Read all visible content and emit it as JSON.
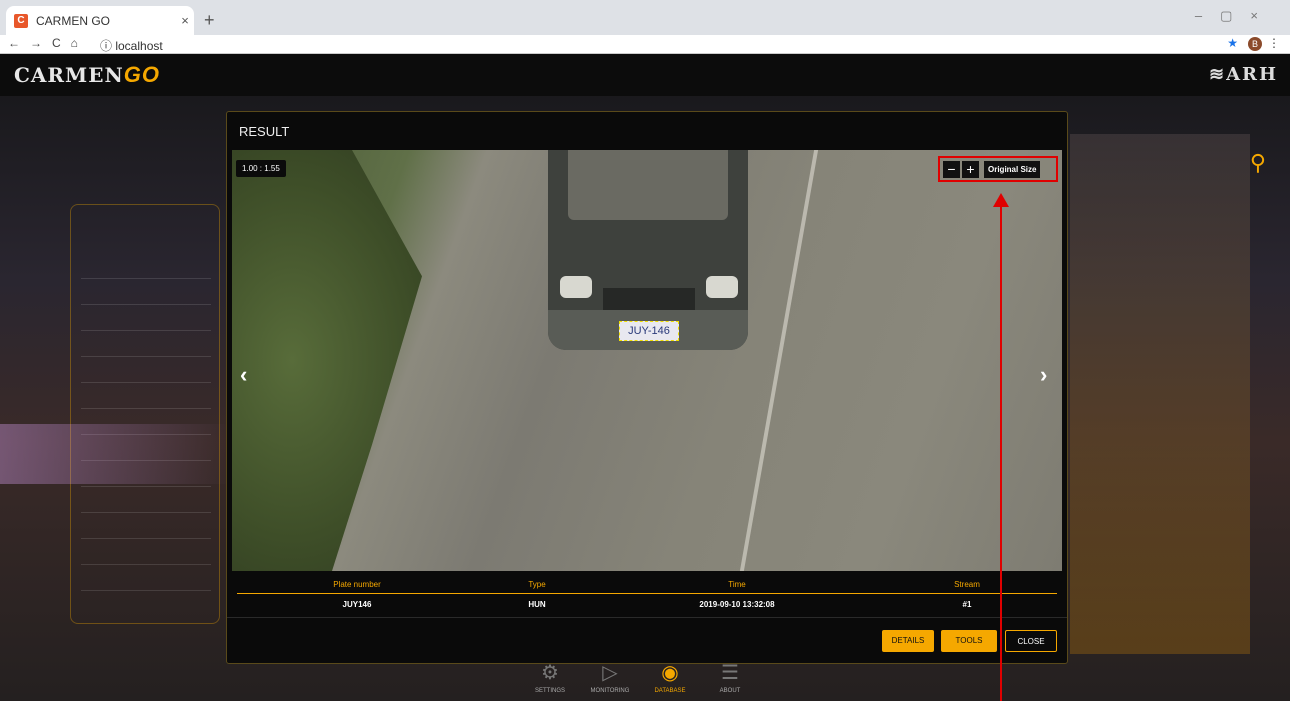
{
  "browser": {
    "tab_title": "CARMEN GO",
    "url": "localhost",
    "profile_initial": "B"
  },
  "app": {
    "logo_text": "CARMEN",
    "logo_go": "GO",
    "brand": "ARH"
  },
  "nav": [
    {
      "label": "SETTINGS",
      "icon": "gear-icon"
    },
    {
      "label": "MONITORING",
      "icon": "monitor-icon"
    },
    {
      "label": "DATABASE",
      "icon": "database-icon"
    },
    {
      "label": "ABOUT",
      "icon": "chat-icon"
    }
  ],
  "modal": {
    "title": "RESULT",
    "ratio": "1.00 : 1.55",
    "zoom_out": "−",
    "zoom_in": "+",
    "original_size": "Original Size",
    "plate_text": "JUY-146",
    "columns": [
      "Plate number",
      "Type",
      "Time",
      "Stream"
    ],
    "row": {
      "plate": "JUY146",
      "type": "HUN",
      "time": "2019-09-10 13:32:08",
      "stream": "#1"
    },
    "buttons": {
      "details": "DETAILS",
      "tools": "TOOLS",
      "close": "CLOSE"
    }
  },
  "colors": {
    "accent": "#f5a800",
    "annotation": "#e00000"
  }
}
